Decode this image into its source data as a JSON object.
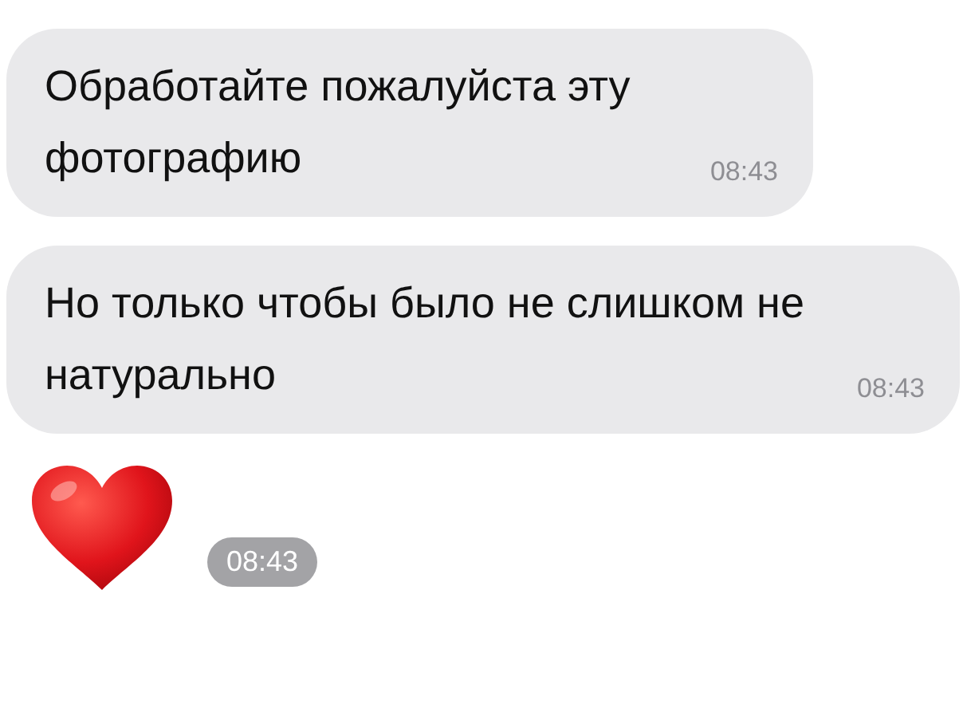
{
  "messages": [
    {
      "kind": "text",
      "text": "Обработайте пожалуйста эту фотографию",
      "time": "08:43"
    },
    {
      "kind": "text",
      "text": "Но только чтобы было не слишком не натурально",
      "time": "08:43"
    },
    {
      "kind": "heart",
      "time": "08:43"
    }
  ]
}
